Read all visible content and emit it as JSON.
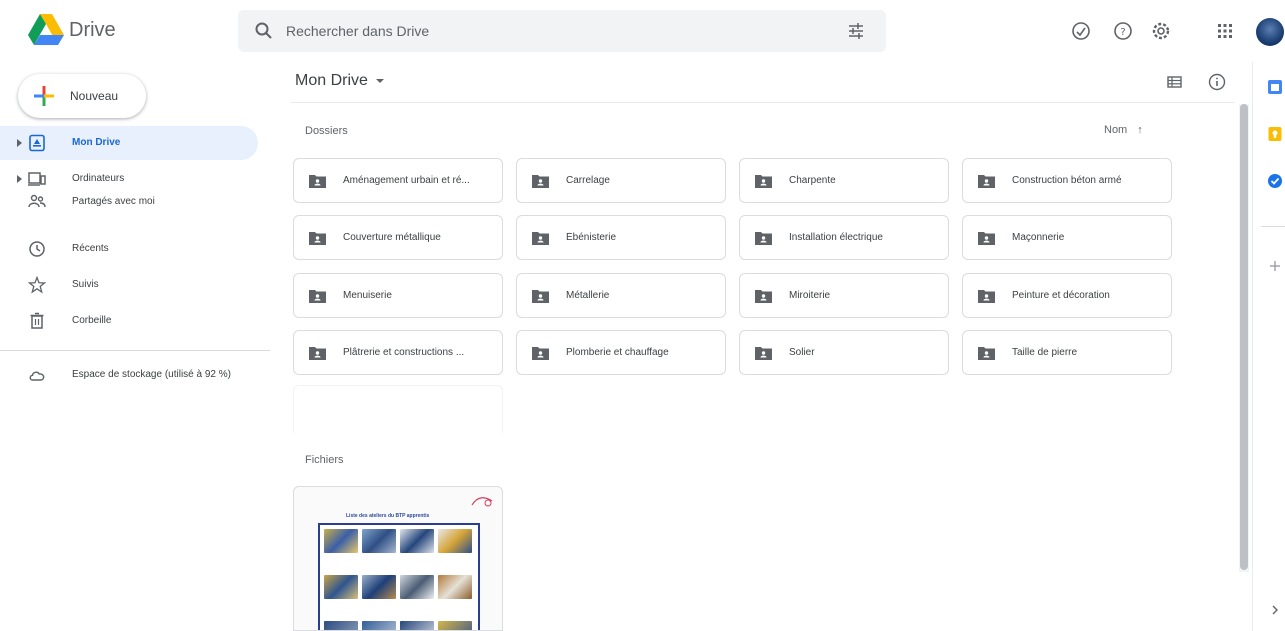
{
  "header": {
    "app_name": "Drive",
    "search_placeholder": "Rechercher dans Drive"
  },
  "sidebar": {
    "new_button": "Nouveau",
    "items": [
      {
        "label": "Mon Drive",
        "icon": "my-drive-icon",
        "active": true
      },
      {
        "label": "Ordinateurs",
        "icon": "computers-icon",
        "active": false
      },
      {
        "label": "Partagés avec moi",
        "icon": "shared-icon",
        "active": false
      },
      {
        "label": "Récents",
        "icon": "clock-icon",
        "active": false
      },
      {
        "label": "Suivis",
        "icon": "star-icon",
        "active": false
      },
      {
        "label": "Corbeille",
        "icon": "trash-icon",
        "active": false
      }
    ],
    "storage_label": "Espace de stockage (utilisé à 92 %)"
  },
  "main": {
    "title": "Mon Drive",
    "folders_label": "Dossiers",
    "sort_label": "Nom",
    "files_label": "Fichiers",
    "folders": [
      "Aménagement urbain et ré...",
      "Carrelage",
      "Charpente",
      "Construction béton armé",
      "Couverture métallique",
      "Ébénisterie",
      "Installation électrique",
      "Maçonnerie",
      "Menuiserie",
      "Métallerie",
      "Miroiterie",
      "Peinture et décoration",
      "Plâtrerie et constructions ...",
      "Plomberie et chauffage",
      "Solier",
      "Taille de pierre"
    ],
    "file_thumbnail_title": "Liste des ateliers du BTP  apprentis"
  },
  "colors": {
    "accent": "#1967d2",
    "active_bg": "#e8f0fe",
    "folder_icon": "#5f6368"
  }
}
